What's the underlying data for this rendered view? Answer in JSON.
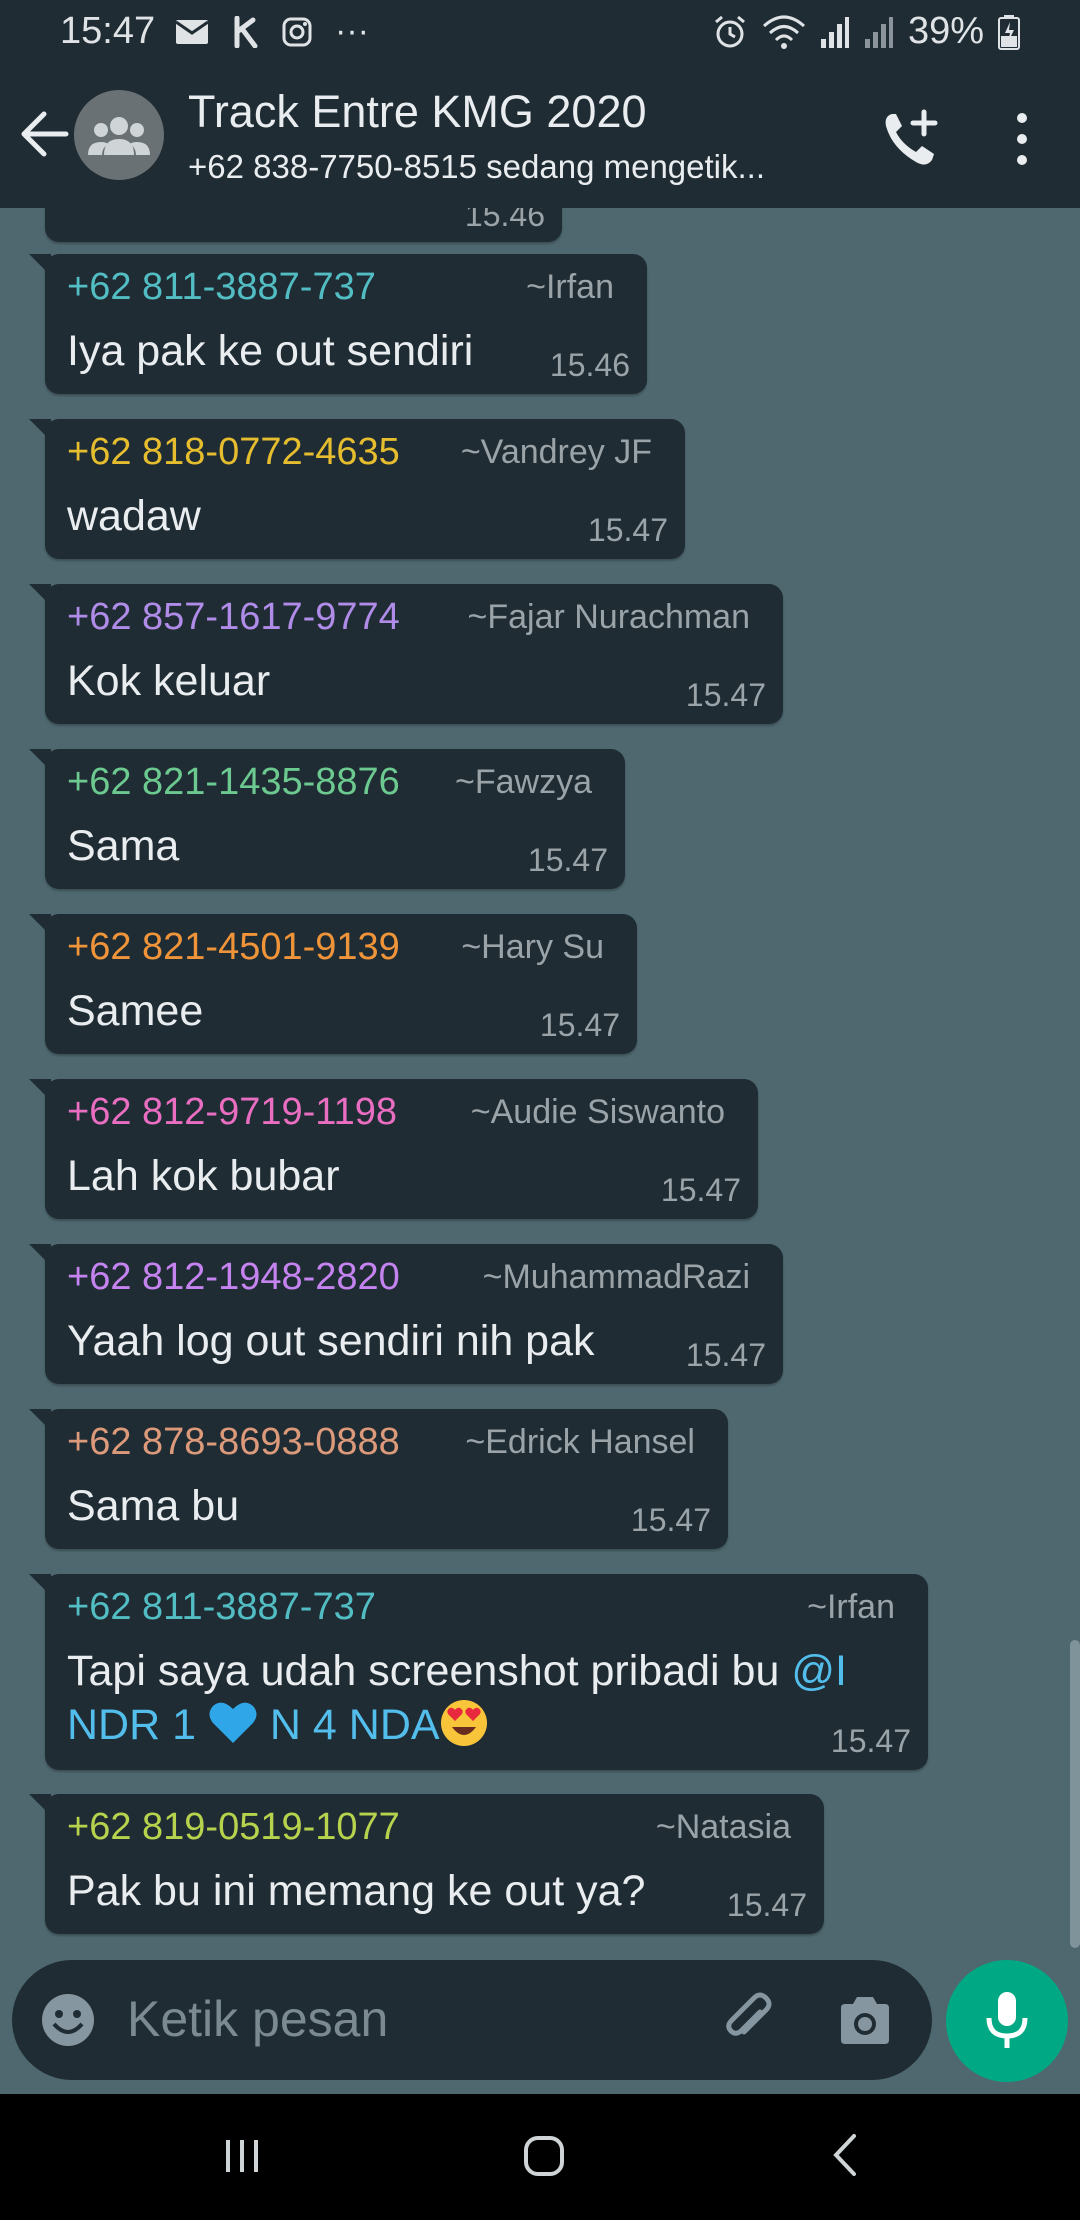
{
  "status_bar": {
    "time": "15:47",
    "battery": "39%",
    "more": "···"
  },
  "header": {
    "title": "Track Entre KMG 2020",
    "subtitle": "+62 838-7750-8515 sedang mengetik..."
  },
  "partial_message_time": "15.46",
  "messages": [
    {
      "phone": "+62 811-3887-737",
      "name": "~Irfan",
      "text": "Iya pak ke out sendiri",
      "time": "15.46",
      "phone_color": "#53bdc4"
    },
    {
      "phone": "+62 818-0772-4635",
      "name": "~Vandrey JF",
      "text": "wadaw",
      "time": "15.47",
      "phone_color": "#e6bd2e"
    },
    {
      "phone": "+62 857-1617-9774",
      "name": "~Fajar Nurachman",
      "text": "Kok keluar",
      "time": "15.47",
      "phone_color": "#b08ce8"
    },
    {
      "phone": "+62 821-1435-8876",
      "name": "~Fawzya",
      "text": "Sama",
      "time": "15.47",
      "phone_color": "#6cc98f"
    },
    {
      "phone": "+62 821-4501-9139",
      "name": "~Hary Su",
      "text": "Samee",
      "time": "15.47",
      "phone_color": "#f0943a"
    },
    {
      "phone": "+62 812-9719-1198",
      "name": "~Audie Siswanto",
      "text": "Lah kok bubar",
      "time": "15.47",
      "phone_color": "#e96ec2"
    },
    {
      "phone": "+62 812-1948-2820",
      "name": "~MuhammadRazi",
      "text": "Yaah log out sendiri nih pak",
      "time": "15.47",
      "phone_color": "#c583f0"
    },
    {
      "phone": "+62 878-8693-0888",
      "name": "~Edrick Hansel",
      "text": "Sama bu",
      "time": "15.47",
      "phone_color": "#dd9a7a"
    },
    {
      "phone": "+62 811-3887-737",
      "name": "~Irfan",
      "text_line1": "Tapi saya udah screenshot pribadi bu ",
      "mention_part1": "@I",
      "mention_part2": "NDR 1 ",
      "mention_part3": " N 4 NDA",
      "time": "15.47",
      "phone_color": "#53bdc4",
      "heart_emoji": "blue-heart-emoji",
      "face_emoji": "heart-eyes-emoji"
    },
    {
      "phone": "+62 819-0519-1077",
      "name": "~Natasia",
      "text": "Pak bu ini memang ke out ya?",
      "time": "15.47",
      "phone_color": "#b7d24c"
    }
  ],
  "input": {
    "placeholder": "Ketik pesan"
  },
  "colors": {
    "chat_bg": "#4f6870",
    "bubble": "#1f2c34",
    "bar": "#1f2c33",
    "accent": "#00a884",
    "mention": "#53bdeb"
  }
}
